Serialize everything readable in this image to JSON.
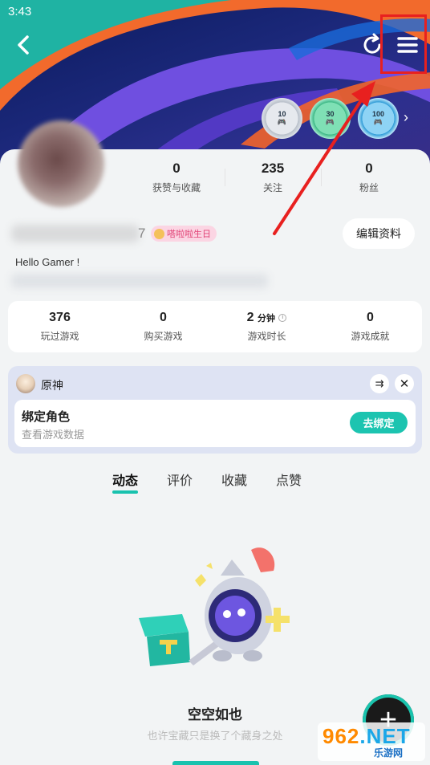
{
  "status_bar": {
    "time": "3:43"
  },
  "header": {
    "back_icon": "chevron-left-icon",
    "refresh_icon": "refresh-icon",
    "menu_icon": "hamburger-menu-icon"
  },
  "badges": [
    {
      "value": "10"
    },
    {
      "value": "30"
    },
    {
      "value": "100"
    }
  ],
  "profile": {
    "name_suffix": "7",
    "birthday_tag": "嗒啦啦生日",
    "edit_button": "编辑资料",
    "bio": "Hello Gamer !"
  },
  "top_stats": [
    {
      "value": "0",
      "label": "获赞与收藏"
    },
    {
      "value": "235",
      "label": "关注"
    },
    {
      "value": "0",
      "label": "粉丝"
    }
  ],
  "game_stats": [
    {
      "value": "376",
      "unit": "",
      "label": "玩过游戏"
    },
    {
      "value": "0",
      "unit": "",
      "label": "购买游戏"
    },
    {
      "value": "2",
      "unit": "分钟",
      "label": "游戏时长"
    },
    {
      "value": "0",
      "unit": "",
      "label": "游戏成就"
    }
  ],
  "game_card": {
    "name": "原神",
    "bind_title": "绑定角色",
    "bind_subtitle": "查看游戏数据",
    "bind_button": "去绑定"
  },
  "tabs": [
    {
      "label": "动态",
      "active": true
    },
    {
      "label": "评价",
      "active": false
    },
    {
      "label": "收藏",
      "active": false
    },
    {
      "label": "点赞",
      "active": false
    }
  ],
  "empty_state": {
    "title": "空空如也",
    "subtitle": "也许宝藏只是换了个藏身之处"
  },
  "fab": {
    "label": "+"
  },
  "watermark": {
    "main_a": "962",
    "main_b": ".NET",
    "sub": "乐游网"
  },
  "colors": {
    "accent": "#19c2ae",
    "highlight": "#e8201f"
  }
}
